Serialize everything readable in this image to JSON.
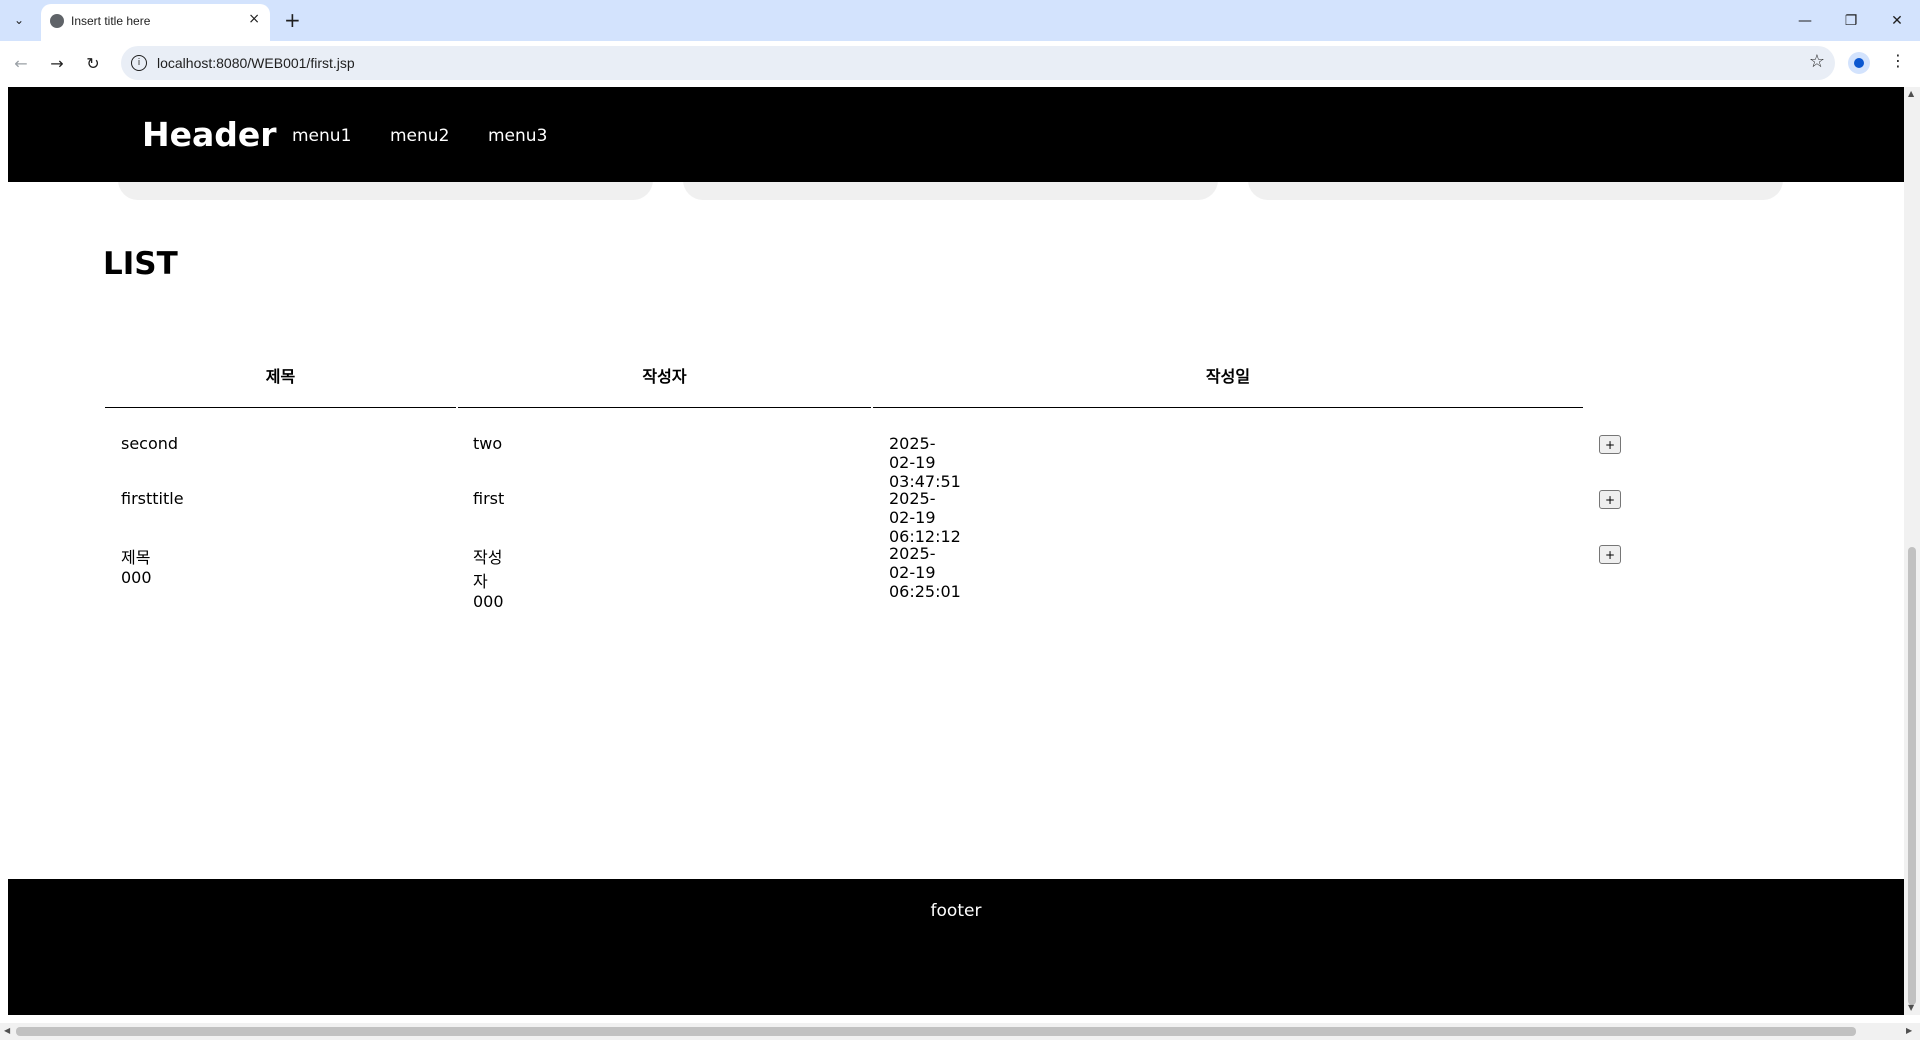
{
  "browser": {
    "tab_title": "Insert title here",
    "tab_close": "×",
    "new_tab": "+",
    "tab_search": "⌄",
    "url": "localhost:8080/WEB001/first.jsp",
    "back": "←",
    "forward": "→",
    "reload": "↻",
    "info": "i",
    "star": "☆",
    "menu": "⋮",
    "minimize": "—",
    "restore": "❐",
    "close": "✕"
  },
  "header": {
    "logo": "Header",
    "menu": [
      "menu1",
      "menu2",
      "menu3"
    ]
  },
  "list": {
    "title": "LIST",
    "columns": [
      "제목",
      "작성자",
      "작성일"
    ],
    "rows": [
      {
        "title": "second",
        "writer": "two",
        "date": "2025-02-19 03:47:51",
        "action": "+"
      },
      {
        "title": "firsttitle",
        "writer": "first",
        "date": "2025-02-19 06:12:12",
        "action": "+"
      },
      {
        "title": "제목000",
        "writer": "작성자000",
        "date": "2025-02-19 06:25:01",
        "action": "+"
      }
    ]
  },
  "footer": {
    "text": "footer"
  }
}
